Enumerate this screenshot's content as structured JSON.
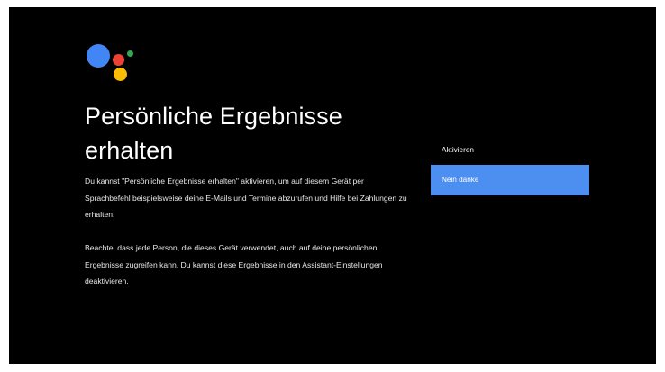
{
  "colors": {
    "background": "#000000",
    "accent": "#4d8ff0",
    "logo_blue": "#4285f4",
    "logo_red": "#ea4335",
    "logo_yellow": "#fbbc05",
    "logo_green": "#34a853"
  },
  "logo": {
    "icon": "google-assistant-icon"
  },
  "title": "Persönliche Ergebnisse erhalten",
  "paragraphs": [
    "Du kannst \"Persönliche Ergebnisse erhalten\" aktivieren, um auf diesem Gerät per Sprachbefehl beispielsweise deine E-Mails und Termine abzurufen und Hilfe bei Zahlungen zu erhalten.",
    "Beachte, dass jede Person, die dieses Gerät verwendet, auch auf deine persönlichen Ergebnisse zugreifen kann. Du kannst diese Ergebnisse in den Assistant-Einstellungen deaktivieren."
  ],
  "options": [
    {
      "label": "Aktivieren",
      "selected": false
    },
    {
      "label": "Nein danke",
      "selected": true
    }
  ]
}
